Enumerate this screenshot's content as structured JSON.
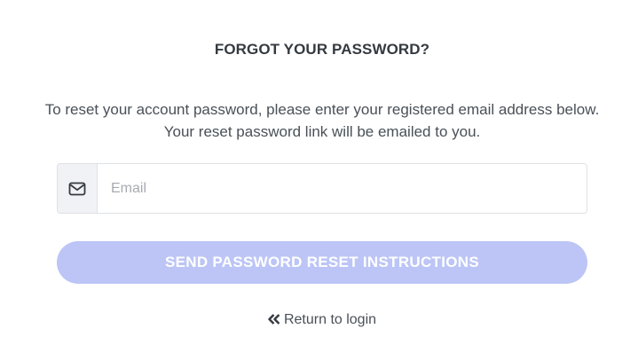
{
  "form": {
    "title": "FORGOT YOUR PASSWORD?",
    "description": "To reset your account password, please enter your registered email address below. Your reset password link will be emailed to you.",
    "email_placeholder": "Email",
    "email_value": "",
    "email_icon": "envelope-icon",
    "submit_label": "SEND PASSWORD RESET INSTRUCTIONS",
    "return_label": "Return to login",
    "return_icon": "double-chevron-left-icon"
  },
  "colors": {
    "title": "#343a40",
    "text": "#495057",
    "button_bg": "#bcc5f6",
    "button_text": "#ffffff",
    "input_border": "#dfe2e6",
    "addon_bg": "#f1f2f6"
  }
}
